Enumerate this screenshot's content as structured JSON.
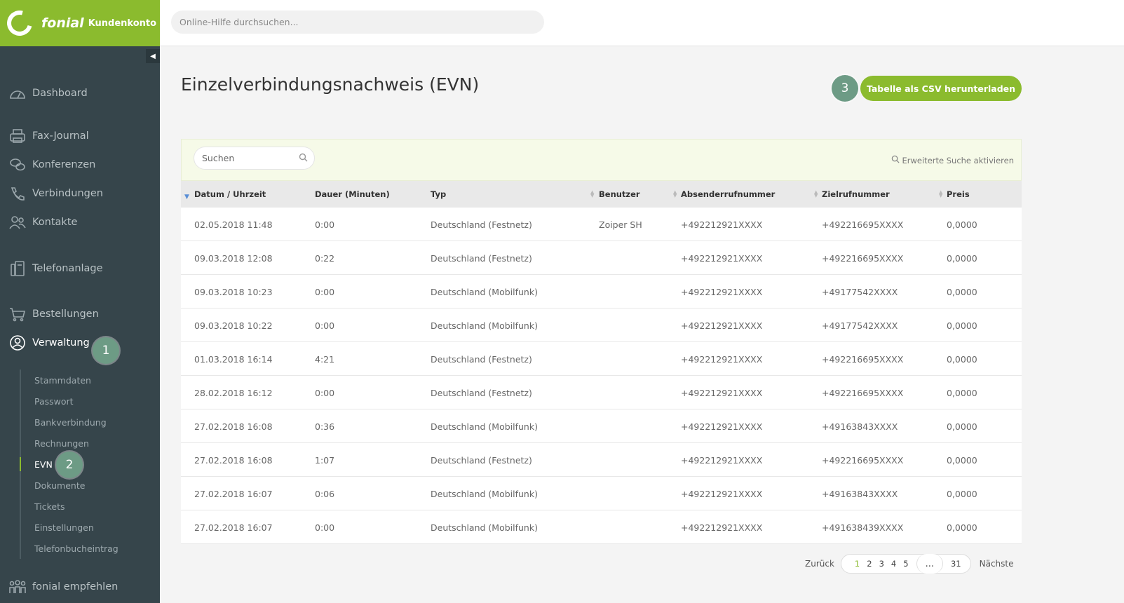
{
  "brand": {
    "name": "fonial",
    "subtitle": "Kundenkonto"
  },
  "topbar": {
    "search_placeholder": "Online-Hilfe durchsuchen..."
  },
  "sidebar": {
    "items": [
      {
        "label": "Dashboard",
        "icon": "speedometer-icon"
      },
      {
        "label": "Fax-Journal",
        "icon": "fax-icon"
      },
      {
        "label": "Konferenzen",
        "icon": "chat-bubbles-icon"
      },
      {
        "label": "Verbindungen",
        "icon": "phone-icon"
      },
      {
        "label": "Kontakte",
        "icon": "contacts-icon"
      },
      {
        "label": "Telefonanlage",
        "icon": "pbx-icon"
      },
      {
        "label": "Bestellungen",
        "icon": "cart-icon"
      },
      {
        "label": "Verwaltung",
        "icon": "user-circle-icon"
      },
      {
        "label": "fonial empfehlen",
        "icon": "people-icon"
      }
    ],
    "sub_items": [
      "Stammdaten",
      "Passwort",
      "Bankverbindung",
      "Rechnungen",
      "EVN",
      "Dokumente",
      "Tickets",
      "Einstellungen",
      "Telefonbucheintrag"
    ],
    "collapse_glyph": "◀"
  },
  "badges": {
    "b1": "1",
    "b2": "2",
    "b3": "3"
  },
  "page": {
    "title": "Einzelverbindungsnachweis (EVN)",
    "csv_button": "Tabelle als CSV herunterladen"
  },
  "filter": {
    "search_placeholder": "Suchen",
    "advanced_search": "Erweiterte Suche aktivieren"
  },
  "table": {
    "columns": [
      "Datum / Uhrzeit",
      "Dauer (Minuten)",
      "Typ",
      "Benutzer",
      "Absenderrufnummer",
      "Zielrufnummer",
      "Preis"
    ],
    "rows": [
      [
        "02.05.2018 11:48",
        "0:00",
        "Deutschland (Festnetz)",
        "Zoiper SH",
        "+492212921XXXX",
        "+492216695XXXX",
        "0,0000"
      ],
      [
        "09.03.2018 12:08",
        "0:22",
        "Deutschland (Festnetz)",
        "",
        "+492212921XXXX",
        "+492216695XXXX",
        "0,0000"
      ],
      [
        "09.03.2018 10:23",
        "0:00",
        "Deutschland (Mobilfunk)",
        "",
        "+492212921XXXX",
        "+49177542XXXX",
        "0,0000"
      ],
      [
        "09.03.2018 10:22",
        "0:00",
        "Deutschland (Mobilfunk)",
        "",
        "+492212921XXXX",
        "+49177542XXXX",
        "0,0000"
      ],
      [
        "01.03.2018 16:14",
        "4:21",
        "Deutschland (Festnetz)",
        "",
        "+492212921XXXX",
        "+492216695XXXX",
        "0,0000"
      ],
      [
        "28.02.2018 16:12",
        "0:00",
        "Deutschland (Festnetz)",
        "",
        "+492212921XXXX",
        "+492216695XXXX",
        "0,0000"
      ],
      [
        "27.02.2018 16:08",
        "0:36",
        "Deutschland (Mobilfunk)",
        "",
        "+492212921XXXX",
        "+49163843XXXX",
        "0,0000"
      ],
      [
        "27.02.2018 16:08",
        "1:07",
        "Deutschland (Festnetz)",
        "",
        "+492212921XXXX",
        "+492216695XXXX",
        "0,0000"
      ],
      [
        "27.02.2018 16:07",
        "0:06",
        "Deutschland (Mobilfunk)",
        "",
        "+492212921XXXX",
        "+49163843XXXX",
        "0,0000"
      ],
      [
        "27.02.2018 16:07",
        "0:00",
        "Deutschland (Mobilfunk)",
        "",
        "+492212921XXXX",
        "+491638439XXXX",
        "0,0000"
      ]
    ]
  },
  "pagination": {
    "prev": "Zurück",
    "next": "Nächste",
    "pages": [
      "1",
      "2",
      "3",
      "4",
      "5"
    ],
    "ellipsis": "...",
    "last": "31"
  },
  "colors": {
    "accent": "#8bbb2e",
    "sidebar": "#36454b",
    "badge": "#6d9b85"
  }
}
